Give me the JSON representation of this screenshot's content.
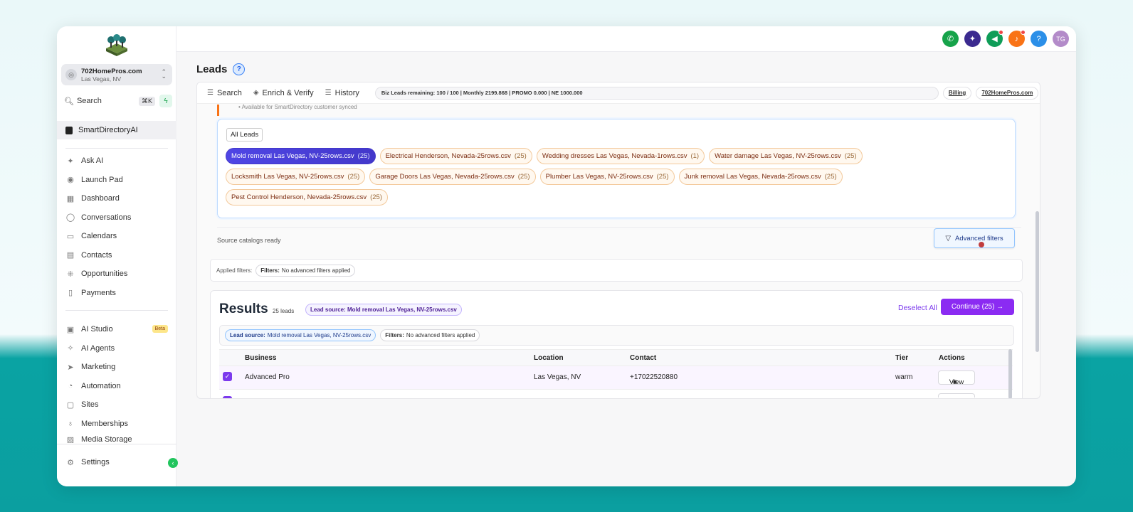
{
  "sidebar": {
    "account": {
      "name": "702HomePros.com",
      "location": "Las Vegas, NV"
    },
    "search": {
      "label": "Search",
      "shortcut": "⌘K"
    },
    "brand": "SmartDirectoryAI",
    "nav_main": [
      {
        "label": "Ask AI",
        "icon": "sparkle-icon"
      },
      {
        "label": "Launch Pad",
        "icon": "rocket-icon"
      },
      {
        "label": "Dashboard",
        "icon": "grid-icon"
      },
      {
        "label": "Conversations",
        "icon": "chat-icon"
      },
      {
        "label": "Calendars",
        "icon": "calendar-icon"
      },
      {
        "label": "Contacts",
        "icon": "contacts-icon"
      },
      {
        "label": "Opportunities",
        "icon": "opportunities-icon"
      },
      {
        "label": "Payments",
        "icon": "payments-icon"
      }
    ],
    "nav_secondary": [
      {
        "label": "AI Studio",
        "icon": "ai-studio-icon",
        "badge": "Beta"
      },
      {
        "label": "AI Agents",
        "icon": "ai-agents-icon"
      },
      {
        "label": "Marketing",
        "icon": "send-icon"
      },
      {
        "label": "Automation",
        "icon": "automation-icon"
      },
      {
        "label": "Sites",
        "icon": "sites-icon"
      },
      {
        "label": "Memberships",
        "icon": "membership-icon"
      },
      {
        "label": "Media Storage",
        "icon": "media-icon"
      }
    ],
    "settings": "Settings"
  },
  "topbar": {
    "avatar_initials": "TG",
    "help": "?"
  },
  "page": {
    "title": "Leads",
    "help": "?"
  },
  "panel_tabs": {
    "search": "Search",
    "enrich": "Enrich & Verify",
    "history": "History"
  },
  "quota_text": "Biz Leads remaining: 100 / 100 | Monthly 2199.868 | PROMO 0.000 | NE 1000.000",
  "links": {
    "billing": "Billing",
    "site": "702HomePros.com"
  },
  "catalog": {
    "truncated_note": "• Available for SmartDirectory customer synced",
    "all_leads": "All Leads",
    "rows": [
      [
        {
          "label": "Mold removal Las Vegas, NV-25rows.csv",
          "count": "(25)",
          "active": true
        },
        {
          "label": "Electrical Henderson, Nevada-25rows.csv",
          "count": "(25)"
        },
        {
          "label": "Wedding dresses Las Vegas, Nevada-1rows.csv",
          "count": "(1)"
        },
        {
          "label": "Water damage Las Vegas, NV-25rows.csv",
          "count": "(25)"
        }
      ],
      [
        {
          "label": "Locksmith Las Vegas, NV-25rows.csv",
          "count": "(25)"
        },
        {
          "label": "Garage Doors Las Vegas, Nevada-25rows.csv",
          "count": "(25)"
        },
        {
          "label": "Plumber Las Vegas, NV-25rows.csv",
          "count": "(25)"
        },
        {
          "label": "Junk removal Las Vegas, Nevada-25rows.csv",
          "count": "(25)"
        }
      ],
      [
        {
          "label": "Pest Control Henderson, Nevada-25rows.csv",
          "count": "(25)"
        }
      ]
    ]
  },
  "source_status": "Source catalogs ready",
  "advanced_filters": "Advanced filters",
  "applied": {
    "label": "Applied filters:",
    "key": "Filters:",
    "value": "No advanced filters applied"
  },
  "results": {
    "title": "Results",
    "count": "25 leads",
    "source_pill": "Lead source: Mold removal Las Vegas, NV-25rows.csv",
    "deselect": "Deselect All",
    "continue": "Continue (25) →",
    "filter_source_key": "Lead source:",
    "filter_source_value": "Mold removal Las Vegas, NV-25rows.csv",
    "filter_key": "Filters:",
    "filter_value": "No advanced filters applied",
    "columns": {
      "business": "Business",
      "location": "Location",
      "contact": "Contact",
      "tier": "Tier",
      "actions": "Actions"
    },
    "rows": [
      {
        "business": "Advanced Pro",
        "location": "Las Vegas, NV",
        "contact": "+17022520880",
        "tier": "warm",
        "action": "View"
      }
    ]
  },
  "colors": {
    "accent": "#8b2bf2",
    "active_chip": "#4f46e5",
    "teal_bg": "#0aa3a3"
  }
}
